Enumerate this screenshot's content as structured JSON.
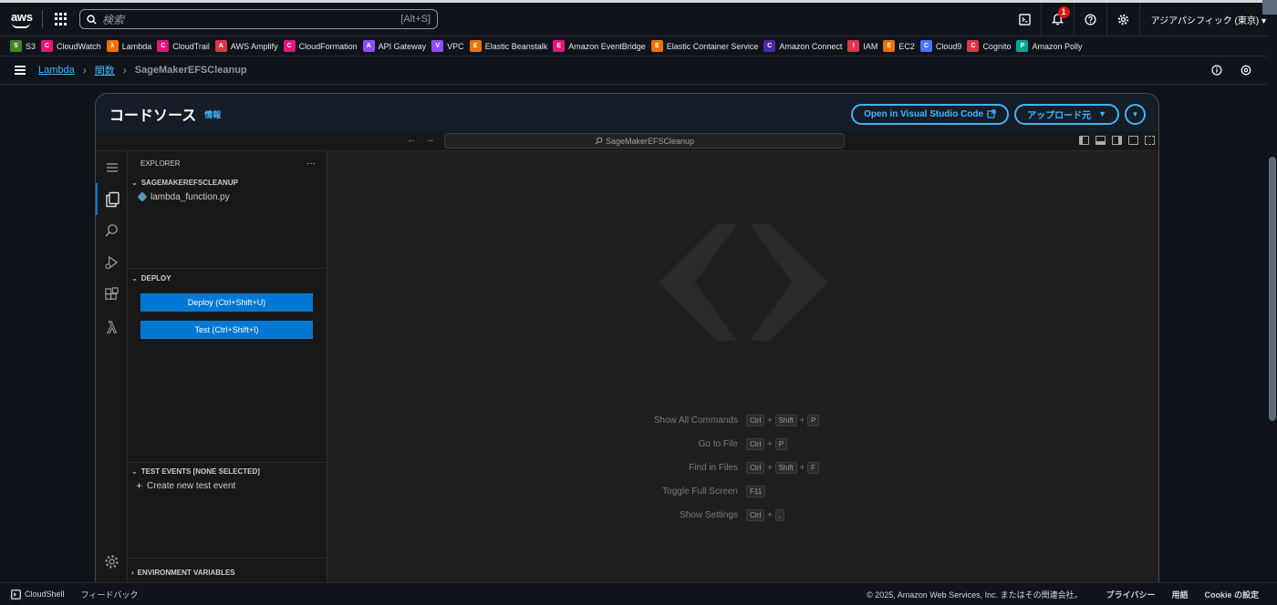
{
  "topbar": {
    "logo": "aws",
    "search_placeholder": "検索",
    "search_shortcut": "[Alt+S]",
    "notification_count": "1",
    "region": "アジアパシフィック (東京) ▾"
  },
  "favorites": [
    {
      "label": "S3",
      "color": "#3f8624",
      "glyph": "S"
    },
    {
      "label": "CloudWatch",
      "color": "#e7157b",
      "glyph": "C"
    },
    {
      "label": "Lambda",
      "color": "#ed7100",
      "glyph": "λ"
    },
    {
      "label": "CloudTrail",
      "color": "#e7157b",
      "glyph": "C"
    },
    {
      "label": "AWS Amplify",
      "color": "#dd344c",
      "glyph": "A"
    },
    {
      "label": "CloudFormation",
      "color": "#e7157b",
      "glyph": "C"
    },
    {
      "label": "API Gateway",
      "color": "#8c4fff",
      "glyph": "A"
    },
    {
      "label": "VPC",
      "color": "#8c4fff",
      "glyph": "V"
    },
    {
      "label": "Elastic Beanstalk",
      "color": "#ed7100",
      "glyph": "E"
    },
    {
      "label": "Amazon EventBridge",
      "color": "#e7157b",
      "glyph": "E"
    },
    {
      "label": "Elastic Container Service",
      "color": "#ed7100",
      "glyph": "E"
    },
    {
      "label": "Amazon Connect",
      "color": "#4d27aa",
      "glyph": "C"
    },
    {
      "label": "IAM",
      "color": "#dd344c",
      "glyph": "I"
    },
    {
      "label": "EC2",
      "color": "#ed7100",
      "glyph": "E"
    },
    {
      "label": "Cloud9",
      "color": "#4d72f3",
      "glyph": "C"
    },
    {
      "label": "Cognito",
      "color": "#dd344c",
      "glyph": "C"
    },
    {
      "label": "Amazon Polly",
      "color": "#01a88d",
      "glyph": "P"
    }
  ],
  "breadcrumb": {
    "items": [
      "Lambda",
      "関数",
      "SageMakerEFSCleanup"
    ]
  },
  "code_source": {
    "title": "コードソース",
    "info_link": "情報",
    "open_vscode": "Open in Visual Studio Code",
    "upload_from": "アップロード元",
    "upload_caret": "▼"
  },
  "ide": {
    "command_center": "SageMakerEFSCleanup",
    "explorer_title": "EXPLORER",
    "explorer_more": "···",
    "folder_name": "SAGEMAKEREFSCLEANUP",
    "file_name": "lambda_function.py",
    "deploy_section": "DEPLOY",
    "deploy_button": "Deploy (Ctrl+Shift+U)",
    "test_button": "Test (Ctrl+Shift+I)",
    "test_events_section": "TEST EVENTS [NONE SELECTED]",
    "create_test_event": "Create new test event",
    "env_vars_section": "ENVIRONMENT VARIABLES",
    "shortcuts": [
      {
        "label": "Show All Commands",
        "keys": [
          "Ctrl",
          "Shift",
          "P"
        ]
      },
      {
        "label": "Go to File",
        "keys": [
          "Ctrl",
          "P"
        ]
      },
      {
        "label": "Find in Files",
        "keys": [
          "Ctrl",
          "Shift",
          "F"
        ]
      },
      {
        "label": "Toggle Full Screen",
        "keys": [
          "F11"
        ]
      },
      {
        "label": "Show Settings",
        "keys": [
          "Ctrl",
          ","
        ]
      }
    ]
  },
  "footer": {
    "cloudshell": "CloudShell",
    "feedback": "フィードバック",
    "copyright": "© 2025, Amazon Web Services, Inc. またはその関連会社。",
    "privacy": "プライバシー",
    "terms": "用語",
    "cookie": "Cookie の設定"
  }
}
